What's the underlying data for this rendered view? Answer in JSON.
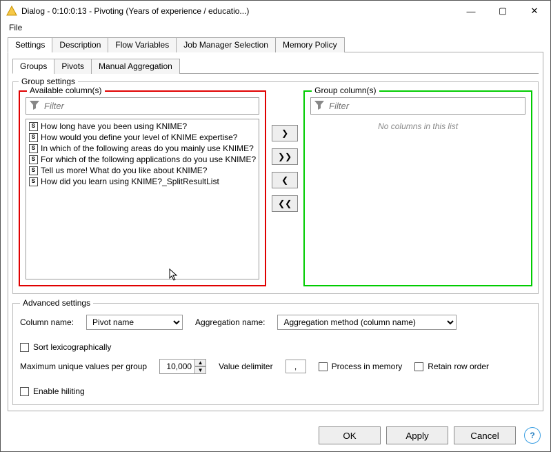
{
  "window": {
    "title": "Dialog - 0:10:0:13 - Pivoting (Years of experience / educatio...)",
    "controls": {
      "min": "—",
      "max": "▢",
      "close": "✕"
    }
  },
  "menubar": {
    "file": "File"
  },
  "tabs": {
    "outer": [
      "Settings",
      "Description",
      "Flow Variables",
      "Job Manager Selection",
      "Memory Policy"
    ],
    "active_outer": 0,
    "inner": [
      "Groups",
      "Pivots",
      "Manual Aggregation"
    ],
    "active_inner": 0
  },
  "group_settings": {
    "legend": "Group settings",
    "available": {
      "label": "Available column(s)",
      "filter_placeholder": "Filter",
      "items": [
        "How long have you been using KNIME?",
        "How would you define your level of KNIME expertise?",
        "In which of the following areas do you mainly use KNIME?",
        "For which of the following applications do you use KNIME?",
        "Tell us more! What do you like about KNIME?",
        "How did you learn using KNIME?_SplitResultList"
      ]
    },
    "transfer": {
      "right": "❯",
      "right_all": "❯❯",
      "left": "❮",
      "left_all": "❮❮"
    },
    "group": {
      "label": "Group column(s)",
      "filter_placeholder": "Filter",
      "empty_text": "No columns in this list"
    }
  },
  "advanced": {
    "legend": "Advanced settings",
    "column_name_label": "Column name:",
    "column_name_value": "Pivot name",
    "aggregation_label": "Aggregation name:",
    "aggregation_value": "Aggregation method (column name)",
    "sort_lex": "Sort lexicographically",
    "max_unique_label": "Maximum unique values per group",
    "max_unique_value": "10,000",
    "value_delim_label": "Value delimiter",
    "value_delim_value": ",",
    "process_mem": "Process in memory",
    "retain_order": "Retain row order",
    "enable_hiliting": "Enable hiliting"
  },
  "buttons": {
    "ok": "OK",
    "apply": "Apply",
    "cancel": "Cancel",
    "help": "?"
  }
}
